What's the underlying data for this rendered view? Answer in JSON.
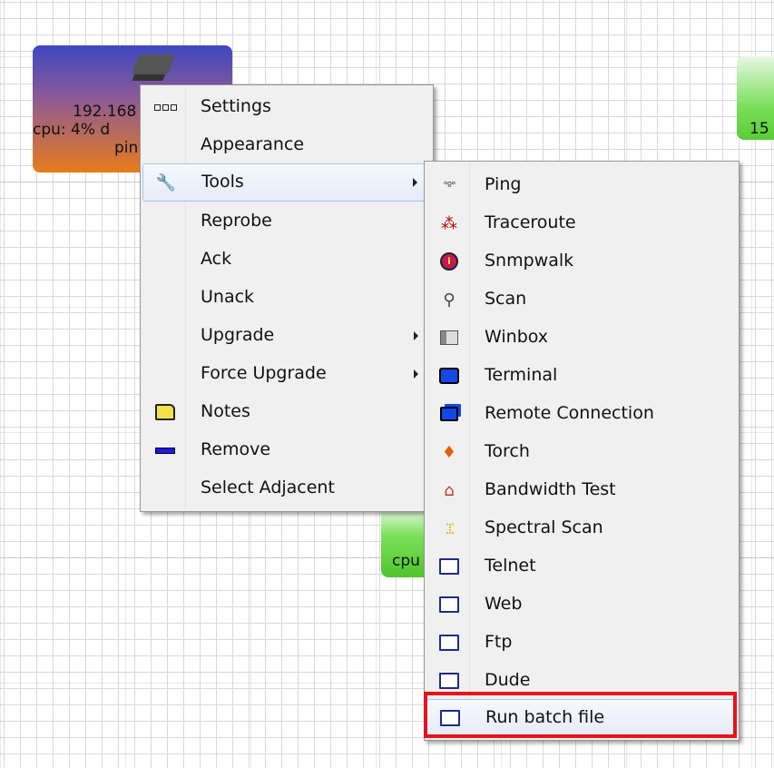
{
  "devices": {
    "main": {
      "line1": "192.168",
      "line2": "cpu: 4%  d",
      "line3": "pin"
    },
    "right": {
      "label": "15"
    },
    "bottom": {
      "label": "cpu"
    }
  },
  "context_menu": {
    "items": [
      {
        "label": "Settings",
        "icon": "dots-icon"
      },
      {
        "label": "Appearance",
        "icon": ""
      },
      {
        "label": "Tools",
        "icon": "wrench-icon",
        "submenu": true,
        "hovered": true
      },
      {
        "label": "Reprobe",
        "icon": ""
      },
      {
        "label": "Ack",
        "icon": ""
      },
      {
        "label": "Unack",
        "icon": ""
      },
      {
        "label": "Upgrade",
        "icon": "",
        "submenu": true
      },
      {
        "label": "Force Upgrade",
        "icon": "",
        "submenu": true
      },
      {
        "label": "Notes",
        "icon": "note-icon"
      },
      {
        "label": "Remove",
        "icon": "remove-icon"
      },
      {
        "label": "Select Adjacent",
        "icon": ""
      }
    ]
  },
  "tools_menu": {
    "items": [
      {
        "label": "Ping",
        "icon": "ping-icon"
      },
      {
        "label": "Traceroute",
        "icon": "traceroute-icon"
      },
      {
        "label": "Snmpwalk",
        "icon": "snmpwalk-icon"
      },
      {
        "label": "Scan",
        "icon": "scan-icon"
      },
      {
        "label": "Winbox",
        "icon": "winbox-icon"
      },
      {
        "label": "Terminal",
        "icon": "terminal-icon"
      },
      {
        "label": "Remote Connection",
        "icon": "remote-connection-icon"
      },
      {
        "label": "Torch",
        "icon": "torch-icon"
      },
      {
        "label": "Bandwidth Test",
        "icon": "bandwidth-test-icon"
      },
      {
        "label": "Spectral Scan",
        "icon": "spectral-scan-icon"
      },
      {
        "label": "Telnet",
        "icon": "window-icon"
      },
      {
        "label": "Web",
        "icon": "window-icon"
      },
      {
        "label": "Ftp",
        "icon": "window-icon"
      },
      {
        "label": "Dude",
        "icon": "window-icon"
      },
      {
        "label": "Run batch file",
        "icon": "window-icon",
        "hovered": true
      }
    ]
  },
  "colors": {
    "highlight_border": "#e8131b",
    "hover_border": "#a8c6ea"
  }
}
